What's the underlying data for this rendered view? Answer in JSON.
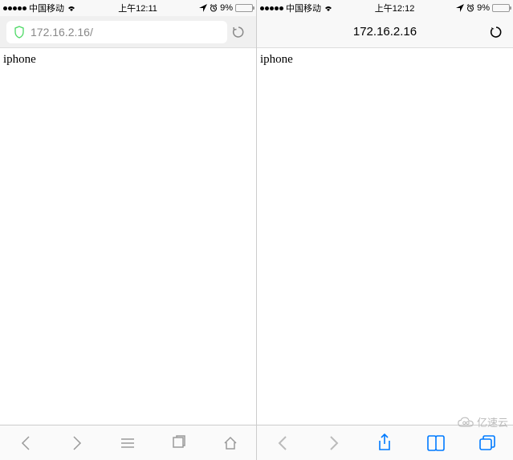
{
  "left": {
    "status": {
      "carrier": "中国移动",
      "time": "上午12:11",
      "battery_pct": "9%"
    },
    "url": "172.16.2.16/",
    "page_text": "iphone"
  },
  "right": {
    "status": {
      "carrier": "中国移动",
      "time": "上午12:12",
      "battery_pct": "9%"
    },
    "url": "172.16.2.16",
    "page_text": "iphone"
  },
  "watermark": "亿速云"
}
